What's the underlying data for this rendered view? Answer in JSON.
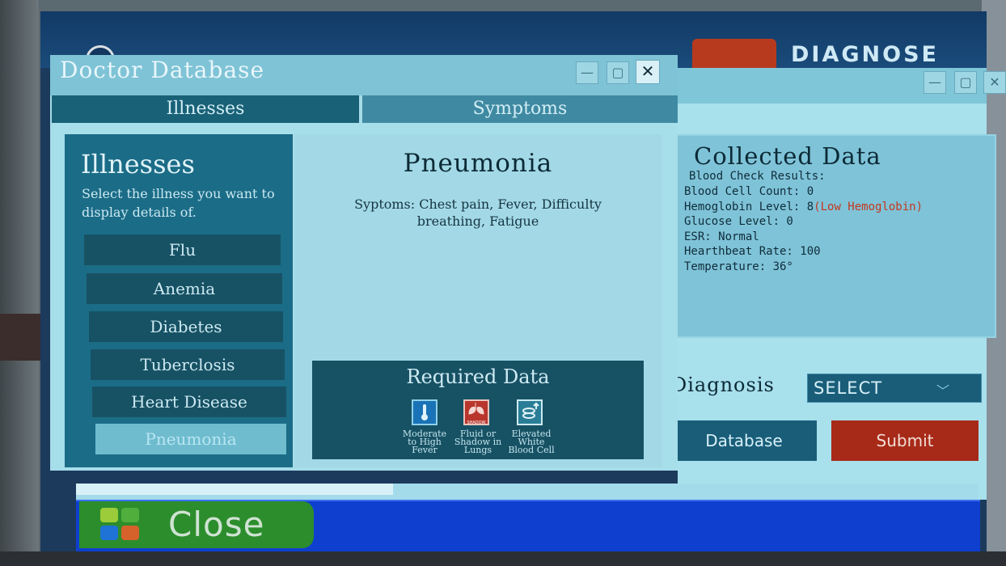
{
  "colors": {
    "accent_dark": "#196177",
    "panel_teal": "#1b6c87",
    "submit_red": "#a72a18",
    "taskbar_blue": "#0f3fcf",
    "close_green": "#2c8d2c",
    "warning_text": "#c2391e"
  },
  "background_window": {
    "header_button": "DIAGNOSE",
    "collected_data": {
      "title": "Collected Data",
      "subtitle": "Blood Check Results:",
      "lines": [
        {
          "text": "Blood Cell Count: 0",
          "note": ""
        },
        {
          "text": "Hemoglobin Level: 8",
          "note": "(Low Hemoglobin)"
        },
        {
          "text": "Glucose Level: 0",
          "note": ""
        },
        {
          "text": "ESR: Normal",
          "note": ""
        },
        {
          "text": "Hearthbeat Rate: 100",
          "note": ""
        },
        {
          "text": "Temperature: 36°",
          "note": ""
        }
      ]
    },
    "diagnosis_label": "Diagnosis",
    "diagnosis_select": "SELECT",
    "database_button": "Database",
    "submit_button": "Submit"
  },
  "window": {
    "title": "Doctor Database",
    "minimize_icon": "minimize-icon",
    "maximize_icon": "maximize-icon",
    "close_icon": "close-icon",
    "tabs": [
      "Illnesses",
      "Symptoms"
    ]
  },
  "illnesses": {
    "heading": "Illnesses",
    "instruction": "Select the illness you want to display details of.",
    "items": [
      "Flu",
      "Anemia",
      "Diabetes",
      "Tuberclosis",
      "Heart Disease",
      "Pneumonia"
    ],
    "selected": "Pneumonia"
  },
  "detail": {
    "name": "Pneumonia",
    "symptoms": "Syptoms: Chest pain, Fever, Difficulty breathing, Fatigue",
    "required_title": "Required Data",
    "required": [
      {
        "icon": "thermometer-icon",
        "caption": [
          "Moderate",
          "to High",
          "Fever"
        ]
      },
      {
        "icon": "lungs-shadow-icon",
        "icon_label": "SHADOW",
        "caption": [
          "Fluid or",
          "Shadow in",
          "Lungs"
        ]
      },
      {
        "icon": "blood-cell-up-icon",
        "caption": [
          "Elevated",
          "White",
          "Blood Cell"
        ]
      }
    ]
  },
  "taskbar": {
    "close_label": "Close",
    "logo_icon": "app-logo-icon"
  }
}
